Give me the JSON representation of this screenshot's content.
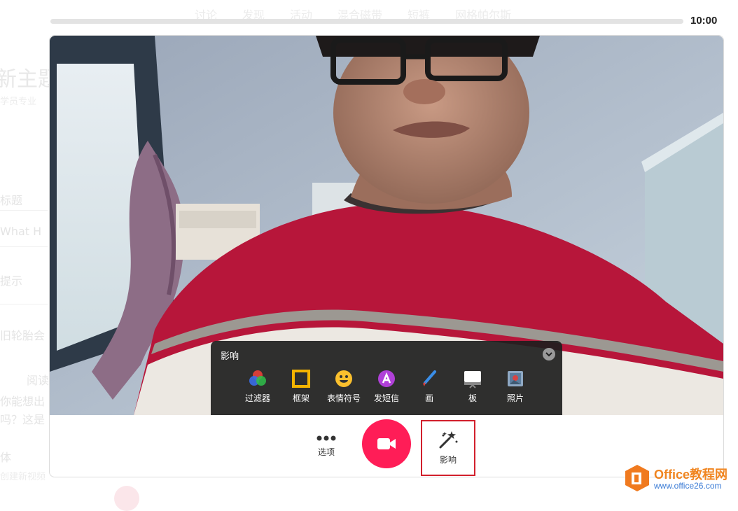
{
  "background_page": {
    "nav": [
      "讨论",
      "发现",
      "活动",
      "混合磁带",
      "短裤",
      "网格帕尔斯"
    ],
    "fragments": [
      "新主题",
      "学员专业",
      "标题",
      "What H",
      "提示",
      "旧轮胎会",
      "阅读",
      "你能想出",
      "吗？这是",
      "体",
      "创建新视频"
    ]
  },
  "recorder": {
    "timer": "10:00",
    "progress": 0,
    "effects_panel": {
      "title": "影响",
      "items": [
        {
          "label": "过滤器",
          "icon": "filter-icon"
        },
        {
          "label": "框架",
          "icon": "frame-icon"
        },
        {
          "label": "表情符号",
          "icon": "emoji-icon"
        },
        {
          "label": "发短信",
          "icon": "text-icon"
        },
        {
          "label": "画",
          "icon": "brush-icon"
        },
        {
          "label": "板",
          "icon": "board-icon"
        },
        {
          "label": "照片",
          "icon": "photo-icon"
        }
      ]
    },
    "controls": {
      "options_label": "选项",
      "effects_label": "影响"
    },
    "colors": {
      "record": "#ff1d57",
      "highlight_box": "#d2202c"
    }
  },
  "watermark": {
    "line1": "Office教程网",
    "line2": "www.office26.com"
  }
}
